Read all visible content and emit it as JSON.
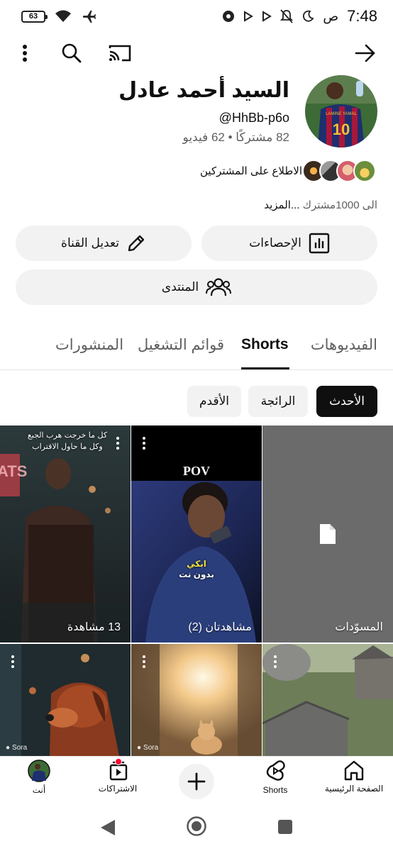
{
  "status_bar": {
    "time": "7:48",
    "ampm": "ص",
    "battery": "63"
  },
  "profile": {
    "name": "السيد أحمد عادل",
    "handle": "@HhBb-p6o",
    "stats": "82 مشتركًا • 62 فيديو",
    "subscribers_link": "الاطلاع على المشتركين",
    "desc_main": "الى 1000مشترك",
    "desc_more": " ...المزيد",
    "avatar_jersey_text": "LAMINE YAMAL",
    "avatar_number": "10"
  },
  "buttons": {
    "stats": "الإحصاءات",
    "edit_channel": "تعديل القناة",
    "forum": "المنتدى"
  },
  "tabs": [
    {
      "label": "الفيديوهات"
    },
    {
      "label": "Shorts"
    },
    {
      "label": "قوائم التشغيل"
    },
    {
      "label": "المنشورات"
    }
  ],
  "chips": [
    {
      "label": "الأحدث"
    },
    {
      "label": "الرائجة"
    },
    {
      "label": "الأقدم"
    }
  ],
  "tiles": {
    "drafts_label": "المسوّدات",
    "pov_title": "POV",
    "pov_caption_1": "ابكي",
    "pov_caption_2": "بدون نت",
    "pov_views": "مشاهدتان (2)",
    "man_views": "13 مشاهدة",
    "man_caption": "كل ما خرجت هرب الجبع وكل ما حاول الاقتراب",
    "man_sign": "ATS",
    "sora": "Sora"
  },
  "bottom_nav": {
    "home": "الصفحة الرئيسية",
    "shorts": "Shorts",
    "subscriptions": "الاشتراكات",
    "you": "أنت"
  },
  "colors": {
    "text": "#0f0f0f",
    "muted": "#606060",
    "pill_bg": "#f2f2f2",
    "notification_dot": "#ff0033"
  }
}
